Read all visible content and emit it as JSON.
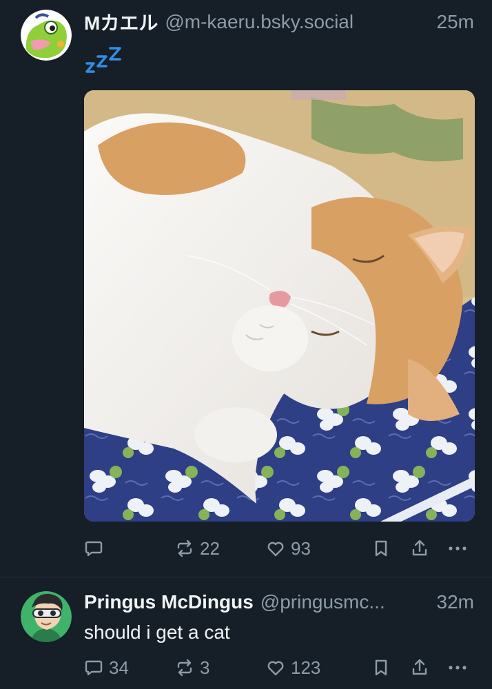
{
  "posts": [
    {
      "author": {
        "display_name": "Mカエル",
        "handle": "@m-kaeru.bsky.social",
        "avatar_icon": "green-frog-avatar"
      },
      "time": "25m",
      "text_emoji": "zzz-sleeping-emoji",
      "image": {
        "subject": "sleeping orange and white cat on blue floral cushion",
        "colors": {
          "fur_orange": "#d9a063",
          "fur_white": "#f4f2ef",
          "cushion_blue": "#2e3f86",
          "tatami": "#d8c08f"
        }
      },
      "actions": {
        "reply_count": "",
        "repost_count": "22",
        "like_count": "93"
      }
    },
    {
      "author": {
        "display_name": "Pringus McDingus",
        "handle": "@pringusmc...",
        "avatar_icon": "cartoon-goggles-avatar"
      },
      "time": "32m",
      "text": "should i get a cat",
      "actions": {
        "reply_count": "34",
        "repost_count": "3",
        "like_count": "123"
      }
    }
  ],
  "theme": {
    "background": "#161e27",
    "text_primary": "#f1f3f5",
    "text_secondary": "#8d9ca9",
    "divider": "#2b3641"
  }
}
